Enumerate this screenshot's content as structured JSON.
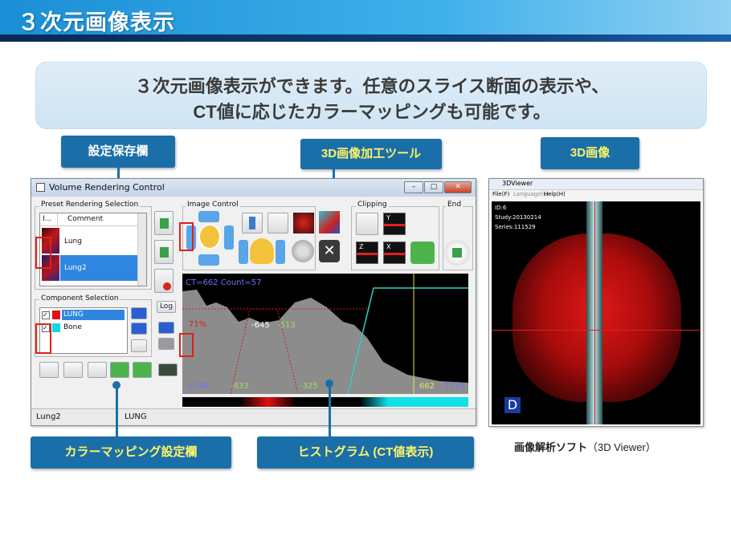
{
  "header": {
    "title": "３次元画像表示"
  },
  "banner": {
    "line1": "３次元画像表示ができます。任意のスライス断面の表示や、",
    "line2": "CT値に応じたカラーマッピングも可能です。"
  },
  "callouts": {
    "preset_save": "設定保存欄",
    "tool": "3D画像加工ツール",
    "image": "3D画像",
    "color_map": "カラーマッピング設定欄",
    "histogram": "ヒストグラム (CT値表示)"
  },
  "window": {
    "title": "Volume Rendering Control",
    "groups": {
      "preset": "Preset Rendering Selection",
      "image_control": "Image Control",
      "clipping": "Clipping",
      "end": "End",
      "component": "Component Selection"
    },
    "preset_table": {
      "columns": [
        "I...",
        "Comment"
      ],
      "rows": [
        "Lung",
        "Lung2"
      ],
      "selected": "Lung2"
    },
    "components": [
      {
        "name": "LUNG",
        "color": "#e0101a",
        "checked": true
      },
      {
        "name": "Bone",
        "color": "#12d8e6",
        "checked": true
      }
    ],
    "log_button": "Log",
    "clip_labels": {
      "y": "Y",
      "z": "Z",
      "x": "X"
    },
    "histogram": {
      "readout": "CT=662 Count=57",
      "pct": "71%",
      "mid_labels": [
        "-645",
        "-513"
      ],
      "axis": [
        "-1294",
        "-833",
        "-325",
        "662",
        "1115"
      ]
    },
    "status": {
      "left": "Lung2",
      "right": "LUNG"
    }
  },
  "viewer": {
    "title": "3DViewer",
    "menu": [
      "File(F)",
      "Language(L)",
      "Help(H)"
    ],
    "id": "ID:6",
    "study": "Study:20130214",
    "series": "Series:111529",
    "orientation": "D"
  },
  "caption": {
    "bold": "画像解析ソフト",
    "rest": "（3D Viewer）"
  },
  "colors": {
    "accent": "#1b6fa8",
    "callout_yellow": "#fff46a",
    "lung_red": "#e0101a",
    "bone_cyan": "#12d8e6"
  },
  "icons": [
    "move-icon",
    "resize-icon",
    "cube-red-icon",
    "cube-color-icon",
    "gear-icon",
    "close-x-icon",
    "undo-arrow-icon",
    "export-icon",
    "rotate-icon",
    "arrow-up-icon",
    "arrow-down-icon",
    "arrow-left-icon",
    "arrow-right-icon",
    "face-icon",
    "add-icon",
    "delete-icon"
  ]
}
